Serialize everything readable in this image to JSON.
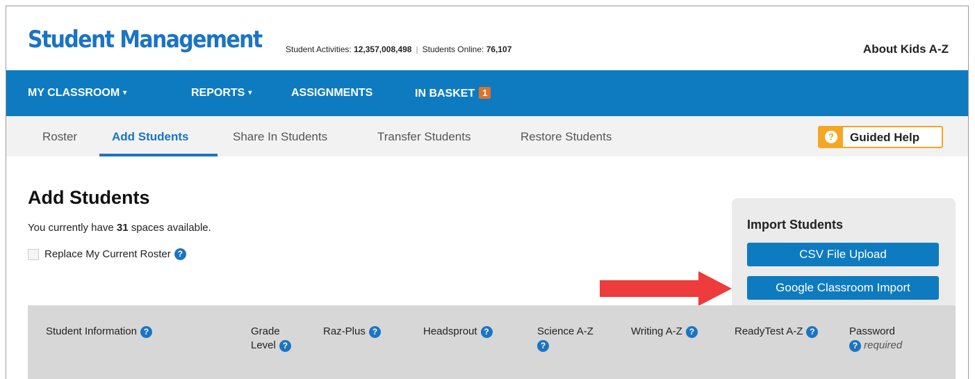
{
  "header": {
    "logo": "Student Management",
    "stats": {
      "activities_label": "Student Activities:",
      "activities_value": "12,357,008,498",
      "separator": "|",
      "online_label": "Students Online:",
      "online_value": "76,107"
    },
    "about_link": "About Kids A-Z"
  },
  "main_nav": {
    "items": [
      {
        "label": "MY CLASSROOM",
        "dropdown": "▾"
      },
      {
        "label": "REPORTS",
        "dropdown": "▾"
      },
      {
        "label": "ASSIGNMENTS"
      },
      {
        "label": "IN BASKET",
        "badge": "1"
      }
    ]
  },
  "sub_nav": {
    "tabs": [
      "Roster",
      "Add Students",
      "Share In Students",
      "Transfer Students",
      "Restore Students"
    ],
    "active_tab": "Add Students",
    "guided_help": {
      "icon": "?",
      "label": "Guided Help"
    }
  },
  "content": {
    "title": "Add Students",
    "spaces": {
      "before": "You currently have ",
      "count": "31",
      "after": " spaces available."
    },
    "replace_roster_label": "Replace My Current Roster",
    "help_icon": "?"
  },
  "import_panel": {
    "title": "Import Students",
    "csv_button": "CSV File Upload",
    "google_button": "Google Classroom Import"
  },
  "table": {
    "columns": [
      {
        "label": "Student Information"
      },
      {
        "label": "Grade",
        "label2": "Level"
      },
      {
        "label": "Raz-Plus"
      },
      {
        "label": "Headsprout"
      },
      {
        "label": "Science A-Z"
      },
      {
        "label": "Writing A-Z"
      },
      {
        "label": "ReadyTest A-Z"
      },
      {
        "label": "Password",
        "note": "required"
      }
    ]
  },
  "colors": {
    "brand_blue": "#1b74c3",
    "nav_blue": "#0e7bc0",
    "badge_orange": "#e0712a",
    "help_orange": "#f5a623",
    "arrow_red": "#ee3b3b"
  }
}
